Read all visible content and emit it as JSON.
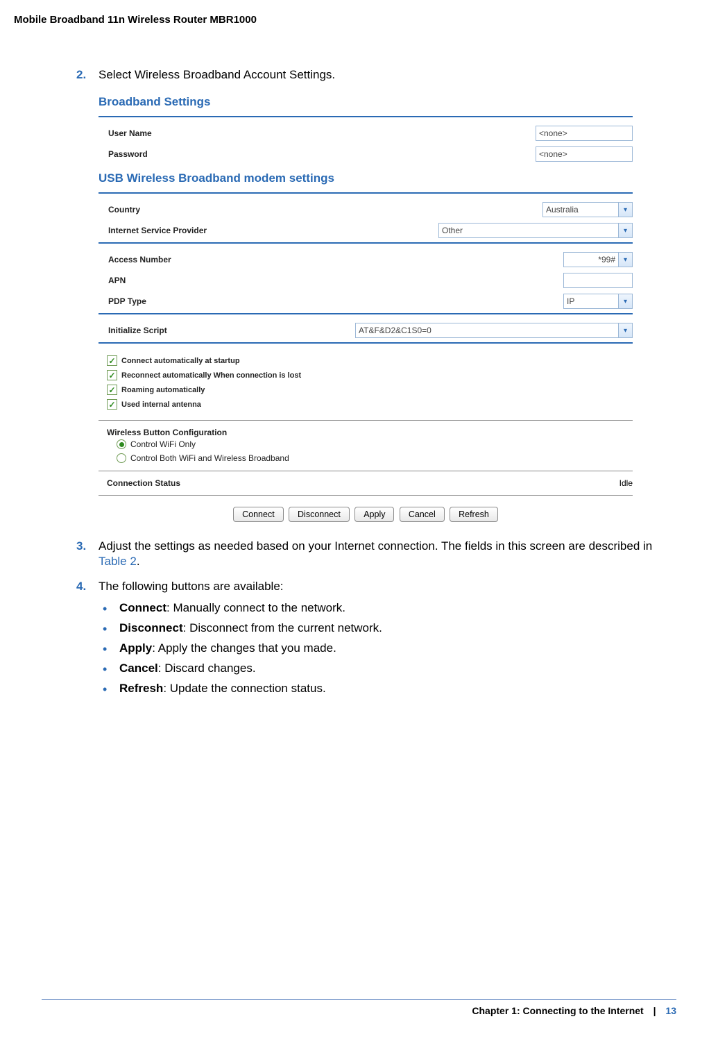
{
  "header": "Mobile Broadband 11n Wireless Router MBR1000",
  "steps": {
    "s2": {
      "num": "2.",
      "text": "Select Wireless Broadband Account Settings."
    },
    "s3": {
      "num": "3.",
      "text_a": "Adjust the settings as needed based on your Internet connection. The fields in this screen are described in ",
      "ref": "Table 2",
      "text_b": "."
    },
    "s4": {
      "num": "4.",
      "text": "The following buttons are available:"
    }
  },
  "shot": {
    "title1": "Broadband Settings",
    "user_lbl": "User Name",
    "user_val": "<none>",
    "pass_lbl": "Password",
    "pass_val": "<none>",
    "title2": "USB Wireless Broadband modem settings",
    "country_lbl": "Country",
    "country_val": "Australia",
    "isp_lbl": "Internet Service Provider",
    "isp_val": "Other",
    "access_lbl": "Access Number",
    "access_val": "*99#",
    "apn_lbl": "APN",
    "apn_val": "",
    "pdp_lbl": "PDP Type",
    "pdp_val": "IP",
    "init_lbl": "Initialize Script",
    "init_val": "AT&F&D2&C1S0=0",
    "chk1": "Connect automatically at startup",
    "chk2": "Reconnect automatically When connection is lost",
    "chk3": "Roaming automatically",
    "chk4": "Used internal antenna",
    "wbc_title": "Wireless Button Configuration",
    "rad1": "Control WiFi Only",
    "rad2": "Control Both WiFi and Wireless Broadband",
    "conn_status_lbl": "Connection Status",
    "conn_status_val": "Idle",
    "btn_connect": "Connect",
    "btn_disconnect": "Disconnect",
    "btn_apply": "Apply",
    "btn_cancel": "Cancel",
    "btn_refresh": "Refresh"
  },
  "bullets": {
    "b1_bold": "Connect",
    "b1_text": ": Manually connect to the network.",
    "b2_bold": "Disconnect",
    "b2_text": ": Disconnect from the current network.",
    "b3_bold": "Apply",
    "b3_text": ": Apply the changes that you made.",
    "b4_bold": "Cancel",
    "b4_text": ": Discard changes.",
    "b5_bold": "Refresh",
    "b5_text": ": Update the connection status."
  },
  "footer": {
    "chapter": "Chapter 1:  Connecting to the Internet",
    "page": "13"
  }
}
